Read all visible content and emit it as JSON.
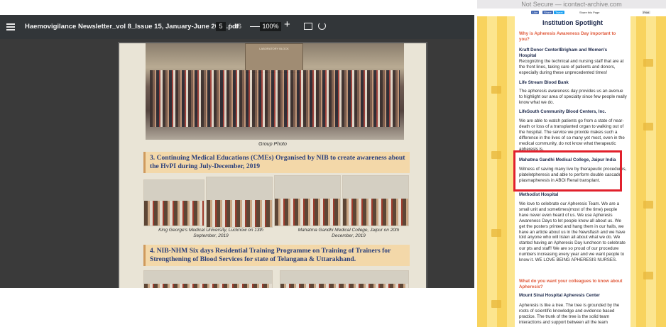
{
  "pdf_viewer": {
    "document_title": "Haemovigilance Newsletter_vol 8_Issue 15, January-June 2020.pdf",
    "current_page": "5",
    "page_separator": "/",
    "total_pages": "16",
    "zoom_level": "100%",
    "zoom_out_label": "—",
    "zoom_in_label": "+",
    "page": {
      "building_sign": "LABORATORY BLOCK",
      "group_photo_caption": "Group Photo",
      "section3_heading": "3. Continuing Medical Educations (CMEs) Organised by NIB to create awareness about the HvPI during July-December, 2019",
      "cme_caption_1": "King George's Medical University, Lucknow on 13th September, 2019",
      "cme_caption_2": "Mahatma Gandhi Medical College, Jaipur on 20th December, 2019",
      "section4_heading": "4. NIB-NHM Six days Residential Training Programme on Training of Trainers for Strengthening of Blood Services for state of Telangana & Uttarakhand."
    }
  },
  "web_page": {
    "url_text": "Not Secure — icontact-archive.com",
    "share_bar": {
      "like": "Like",
      "share": "Share",
      "tweet": "Tweet",
      "share_page": "Share this Page",
      "print": "Print"
    },
    "article_title": "Institution Spotlight",
    "question_1": "Why is Apheresis Awareness Day important to you?",
    "org_1": "Kraft Donor Center/Brigham and Women's Hospital",
    "text_1": "Recognizing the technical and nursing staff that are at the front lines, taking care of patients and donors, especially during these unprecedented times!",
    "org_2": "Life Stream Blood Bank",
    "text_2": "The apheresis awareness day provides us an avenue to highlight our area of specialty since few people really know what we do.",
    "org_3": "LifeSouth Community Blood Centers, Inc.",
    "text_3": "We are able to watch patients go from a state of near-death or loss of a transplanted organ to walking out of the hospital. The service we provide makes such a difference in the lives of so many yet most, even in the medical community, do not know what therapeutic apheresis is.",
    "org_4": "Mahatma Gandhi Medical College, Jaipur India",
    "text_4": "Witness of saving many live by therapeutic procedures, plateletpheresis and able to perform double cascade plasmapheresis in ABOi Renal transplant.",
    "org_5": "Methodist Hospital",
    "text_5": "We love to celebrate our Apheresis Team. We are a small unit and sometimes(most of the time) people have never even heard of us. We use Apheresis Awareness Days to let people know all about us. We get the posters printed and hang them in our halls, we have an article about us in the Newsflash and we have told anyone who will listen all about what we do. We started having an Apheresis Day luncheon to celebrate our pts and staff! We are so proud of our procedure numbers increasing every year and we want people to know it. WE LOVE BEING APHERESIS NURSES.",
    "question_2": "What do you want your colleagues to know about Apheresis?",
    "org_6": "Mount Sinai Hospital Apheresis Center",
    "text_6": "Apheresis is like a tree. The tree is grounded by the roots of scientific knowledge and evidence based practice. The trunk of the tree is the solid team interactions and support between all the team"
  },
  "colors": {
    "highlight_border": "#e1202c",
    "heading_orange": "#e0593a",
    "heading_navy": "#1e2a4c",
    "section_band": "#f3d8a9",
    "viewer_toolbar": "#323639"
  }
}
